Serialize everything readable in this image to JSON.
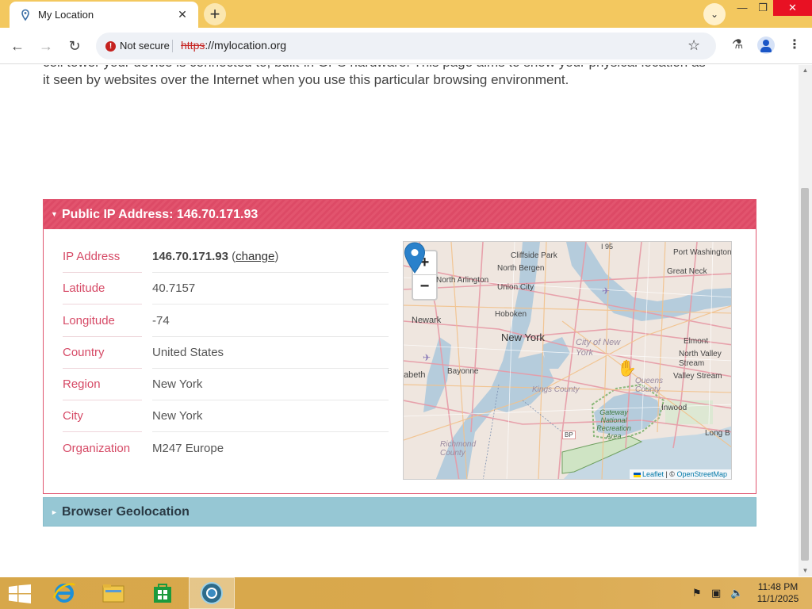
{
  "browser": {
    "tab_title": "My Location",
    "tab_close": "✕",
    "new_tab": "+",
    "security_label": "Not secure",
    "url_scheme": "https",
    "url_rest": "://mylocation.org",
    "window_minimize": "—",
    "window_restore": "❐",
    "window_close": "✕"
  },
  "page": {
    "intro_line1": "cell tower your device is connected to, built-in GPS hardware. This page aims to show your physical location as",
    "intro_line2": "it seen by websites over the Internet when you use this particular browsing environment.",
    "ip_panel_title": "Public IP Address: 146.70.171.93",
    "geo_panel_title": "Browser Geolocation",
    "rows": [
      {
        "label": "IP Address",
        "value": "146.70.171.93"
      },
      {
        "label": "Latitude",
        "value": "40.7157"
      },
      {
        "label": "Longitude",
        "value": "-74"
      },
      {
        "label": "Country",
        "value": "United States"
      },
      {
        "label": "Region",
        "value": "New York"
      },
      {
        "label": "City",
        "value": "New York"
      },
      {
        "label": "Organization",
        "value": "M247 Europe"
      }
    ],
    "change_link": "change",
    "map": {
      "zoom_in": "+",
      "zoom_out": "−",
      "labels": {
        "cliffside": "Cliffside Park",
        "port_washington": "Port Washington",
        "north_bergen": "North Bergen",
        "great_neck": "Great Neck",
        "north_arlington": "North Arlington",
        "union_city": "Union City",
        "newark": "Newark",
        "hoboken": "Hoboken",
        "new_york": "New York",
        "city_of_new_york": "City of New York",
        "elmont": "Elmont",
        "north_valley_stream": "North Valley Stream",
        "valley_stream": "Valley Stream",
        "bayonne": "Bayonne",
        "kings_county": "Kings County",
        "queens_county": "Queens County",
        "inwood": "Inwood",
        "gateway": "Gateway National Recreation Area",
        "richmond_county": "Richmond County",
        "long_beach": "Long B",
        "i95": "I 95",
        "bp": "BP",
        "elizabeth": "abeth"
      },
      "attribution_leaflet": "Leaflet",
      "attribution_sep": " | © ",
      "attribution_osm": "OpenStreetMap"
    }
  },
  "taskbar": {
    "time": "11:48 PM",
    "date": "11/1/2025"
  }
}
